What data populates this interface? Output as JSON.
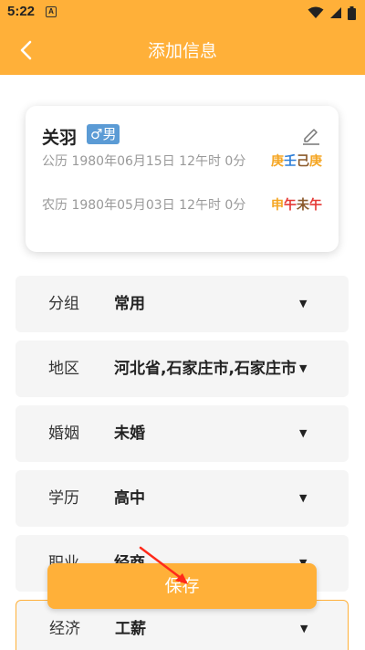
{
  "status": {
    "time": "5:22",
    "notification_glyph": "A",
    "icons": [
      "wifi-icon",
      "signal-icon",
      "battery-icon"
    ]
  },
  "app_bar": {
    "title": "添加信息",
    "back_icon": "chevron-left-icon"
  },
  "profile": {
    "name": "关羽",
    "gender_label": "♂男",
    "solar_date": "公历 1980年06月15日 12午时 0分",
    "lunar_date": "农历 1980年05月03日 12午时 0分",
    "bazi_row1": [
      {
        "char": "庚",
        "color": "#f5a623"
      },
      {
        "char": "壬",
        "color": "#2f7fd8"
      },
      {
        "char": "己",
        "color": "#8b5a2b"
      },
      {
        "char": "庚",
        "color": "#f5a623"
      }
    ],
    "bazi_row2": [
      {
        "char": "申",
        "color": "#f5a623"
      },
      {
        "char": "午",
        "color": "#e53935"
      },
      {
        "char": "未",
        "color": "#8b5a2b"
      },
      {
        "char": "午",
        "color": "#e53935"
      }
    ]
  },
  "fields": [
    {
      "label": "分组",
      "value": "常用"
    },
    {
      "label": "地区",
      "value": "河北省,石家庄市,石家庄市"
    },
    {
      "label": "婚姻",
      "value": "未婚"
    },
    {
      "label": "学历",
      "value": "高中"
    },
    {
      "label": "职业",
      "value": "经商"
    },
    {
      "label": "经济",
      "value": "工薪"
    }
  ],
  "dropdown_arrow": "▼",
  "save_label": "保存",
  "colors": {
    "accent": "#ffb039",
    "field_bg": "#f5f5f5",
    "gender_badge": "#5b9bd5",
    "annotation": "#ff2a1a"
  }
}
